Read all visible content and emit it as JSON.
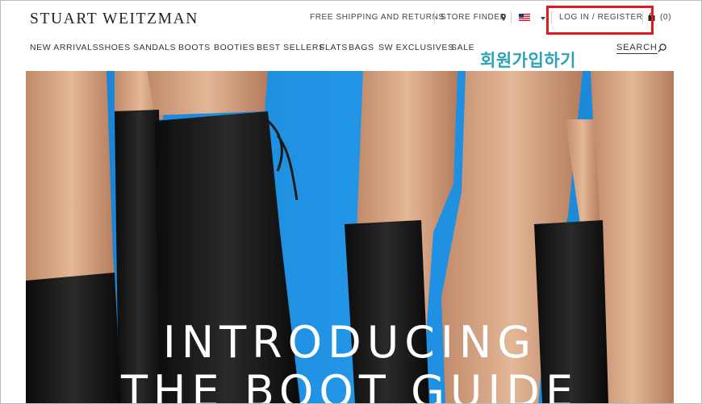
{
  "brand": {
    "logo": "STUART WEITZMAN"
  },
  "utility_bar": {
    "free_shipping": "FREE SHIPPING AND RETURNS",
    "store_finder": "STORE FINDER",
    "login_register": "LOG IN / REGISTER",
    "cart_count": "(0)"
  },
  "nav": {
    "items": [
      {
        "label": "NEW ARRIVALS"
      },
      {
        "label": "SHOES"
      },
      {
        "label": "SANDALS"
      },
      {
        "label": "BOOTS"
      },
      {
        "label": "BOOTIES"
      },
      {
        "label": "BEST SELLERS"
      },
      {
        "label": "FLATS"
      },
      {
        "label": "BAGS"
      },
      {
        "label": "SW EXCLUSIVES"
      },
      {
        "label": "SALE"
      }
    ],
    "search_label": "SEARCH"
  },
  "annotation": {
    "text": "회원가입하기",
    "highlight_color": "#e0191b",
    "text_color": "#2ba3b6"
  },
  "hero": {
    "line1": "INTRODUCING",
    "line2": "THE BOOT GUIDE",
    "background_color": "#1f8ede"
  },
  "icons": [
    "map-pin-icon",
    "us-flag-icon",
    "chevron-down-icon",
    "shopping-bag-icon",
    "search-icon"
  ]
}
